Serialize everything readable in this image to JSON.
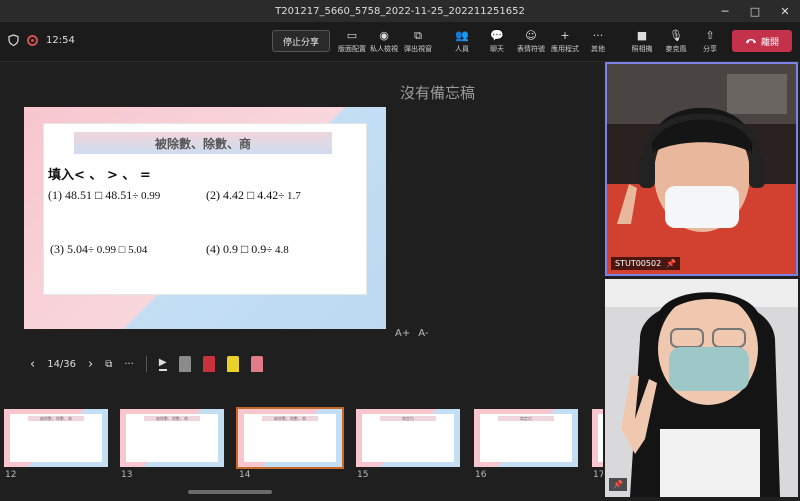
{
  "window": {
    "title": "T201217_5660_5758_2022-11-25_202211251652",
    "controls": [
      "─",
      "□",
      "✕"
    ]
  },
  "toolbar": {
    "time": "12:54",
    "stop_share_label": "停止分享",
    "buttons": [
      {
        "name": "layout-button",
        "icon": "▭",
        "label": "版面配置"
      },
      {
        "name": "private-view-button",
        "icon": "◉",
        "label": "私人檢視"
      },
      {
        "name": "popout-button",
        "icon": "⧉",
        "label": "彈出視窗"
      },
      {
        "name": "people-button",
        "icon": "👥",
        "label": "人員"
      },
      {
        "name": "chat-button",
        "icon": "💬",
        "label": "聊天"
      },
      {
        "name": "react-button",
        "icon": "☺",
        "label": "表情符號"
      },
      {
        "name": "apps-button",
        "icon": "+",
        "label": "應用程式"
      },
      {
        "name": "more-button",
        "icon": "···",
        "label": "其他"
      },
      {
        "name": "camera-button",
        "icon": "■",
        "label": "照相機"
      },
      {
        "name": "mic-button",
        "icon": "🎙",
        "label": "麥克風"
      },
      {
        "name": "share-button",
        "icon": "⇧",
        "label": "分享"
      }
    ],
    "leave_label": "離開"
  },
  "slide": {
    "title": "被除數、除數、商",
    "fill_label": "填入< 、 > 、 =",
    "questions": [
      {
        "a": "(1) 48.51 □ 48.51",
        "b": "÷ 0.99"
      },
      {
        "a": "(2) 4.42 □ 4.42",
        "b": "÷ 1.7"
      },
      {
        "a": "(3) 5.04",
        "b": "÷ 0.99 □ 5.04"
      },
      {
        "a": "(4) 0.9 □ 0.9",
        "b": "÷ 4.8"
      }
    ]
  },
  "notes": {
    "empty_label": "沒有備忘稿"
  },
  "presenter": {
    "font_increase": "A+",
    "font_decrease": "A-",
    "page_indicator": "14/36",
    "pen_colors": [
      "#8a8a8a",
      "#c8323c",
      "#e9d12a",
      "#e27a8a"
    ]
  },
  "thumbnails": [
    {
      "num": "12",
      "title": "被除數、除數、商"
    },
    {
      "num": "13",
      "title": "被除數、除數、商"
    },
    {
      "num": "14",
      "title": "被除數、除數、商",
      "selected": true
    },
    {
      "num": "15",
      "title": "商定位"
    },
    {
      "num": "16",
      "title": "商定位"
    },
    {
      "num": "17",
      "title": ""
    }
  ],
  "participants": [
    {
      "name": "STUT00502",
      "highlighted": true
    },
    {
      "name": "",
      "highlighted": false
    }
  ]
}
